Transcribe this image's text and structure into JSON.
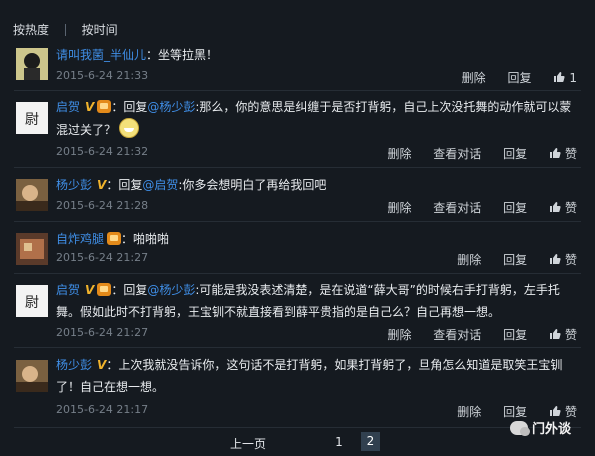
{
  "tabs": {
    "hot": "按热度",
    "time": "按时间"
  },
  "comments": [
    {
      "name": "请叫我菌_半仙儿",
      "text": "：坐等拉黑！",
      "date": "2015-6-24 21:33",
      "actions": {
        "delete": "删除",
        "reply": "回复",
        "likes": "1"
      }
    },
    {
      "name": "启贺",
      "reply_label": "：回复",
      "reply_to": "@杨少彭",
      "text": ":那么，你的意思是纠缠于是否打背躬，自己上次没托舞的动作就可以蒙混过关了？",
      "date": "2015-6-24 21:32",
      "actions": {
        "delete": "删除",
        "view": "查看对话",
        "reply": "回复",
        "like": "赞"
      }
    },
    {
      "name": "杨少彭",
      "reply_label": "：回复",
      "reply_to": "@启贺",
      "text": ":你多会想明白了再给我回吧",
      "date": "2015-6-24 21:28",
      "actions": {
        "delete": "删除",
        "view": "查看对话",
        "reply": "回复",
        "like": "赞"
      }
    },
    {
      "name": "自炸鸡腿",
      "text": "：啪啪啪",
      "date": "2015-6-24 21:27",
      "actions": {
        "delete": "删除",
        "reply": "回复",
        "like": "赞"
      }
    },
    {
      "name": "启贺",
      "reply_label": "：回复",
      "reply_to": "@杨少彭",
      "text": ":可能是我没表述清楚，是在说道“薛大哥”的时候右手打背躬，左手托舞。假如此时不打背躬，王宝钏不就直接看到薛平贵指的是自己么？自己再想一想。",
      "date": "2015-6-24 21:27",
      "actions": {
        "delete": "删除",
        "view": "查看对话",
        "reply": "回复",
        "like": "赞"
      }
    },
    {
      "name": "杨少彭",
      "text": "：上次我就没告诉你，这句话不是打背躬，如果打背躬了，旦角怎么知道是取笑王宝钏了！自己在想一想。",
      "date": "2015-6-24 21:17",
      "actions": {
        "delete": "删除",
        "reply": "回复",
        "like": "赞"
      }
    }
  ],
  "pagination": {
    "prev": "上一页",
    "page1": "1",
    "page2": "2"
  },
  "watermark": "门外谈",
  "colors": {
    "background": "#151a20",
    "link": "#3f8ee6",
    "meta": "#767f89",
    "badge": "#f0b32d"
  }
}
